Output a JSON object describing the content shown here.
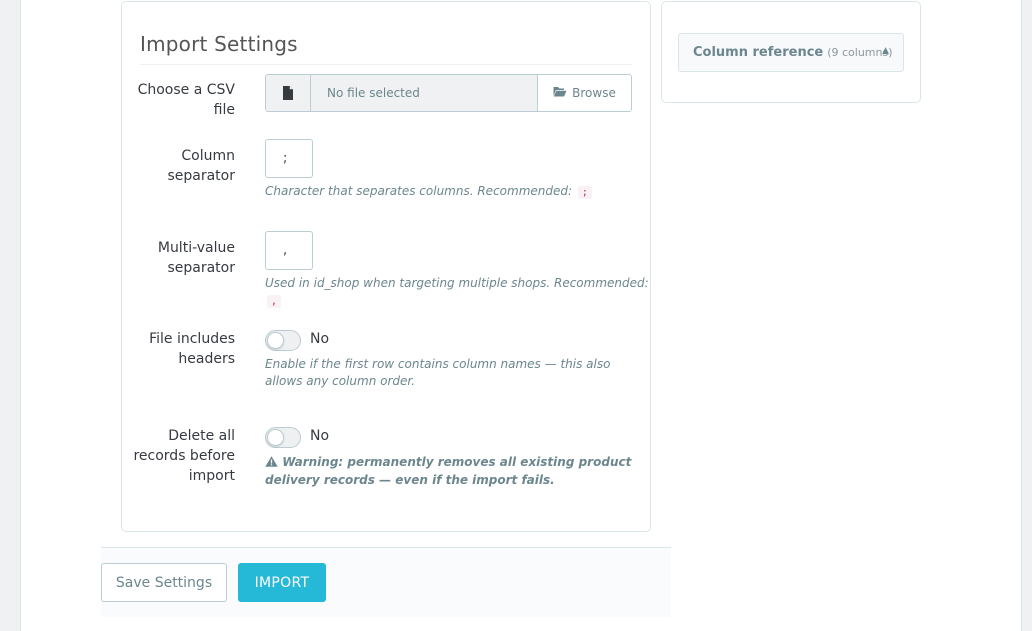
{
  "form": {
    "title": "Import Settings",
    "csv_file": {
      "label": "Choose a CSV file",
      "placeholder": "No file selected",
      "browse_label": "Browse"
    },
    "column_separator": {
      "label": "Column separator",
      "value": ";",
      "help": "Character that separates columns. Recommended:",
      "recommended": ";"
    },
    "multi_value_separator": {
      "label": "Multi-value separator",
      "value": ",",
      "help": "Used in id_shop when targeting multiple shops. Recommended:",
      "recommended": ","
    },
    "headers": {
      "label": "File includes headers",
      "state": "No",
      "help": "Enable if the first row contains column names — this also allows any column order."
    },
    "delete_all": {
      "label": "Delete all records before import",
      "state": "No",
      "warning": "Warning: permanently removes all existing product delivery records — even if the import fails."
    }
  },
  "footer": {
    "save_label": "Save Settings",
    "import_label": "IMPORT"
  },
  "sidebar": {
    "accordion_title": "Column reference",
    "accordion_count": "(9 columns)",
    "caret": "▲"
  },
  "colors": {
    "accent": "#25b9d7",
    "border": "#bbcdd2",
    "help_text": "#6c868e",
    "code_text": "#c7254e"
  },
  "icons": [
    "file-icon",
    "folder-open-icon",
    "warning-icon",
    "caret-up-icon"
  ]
}
